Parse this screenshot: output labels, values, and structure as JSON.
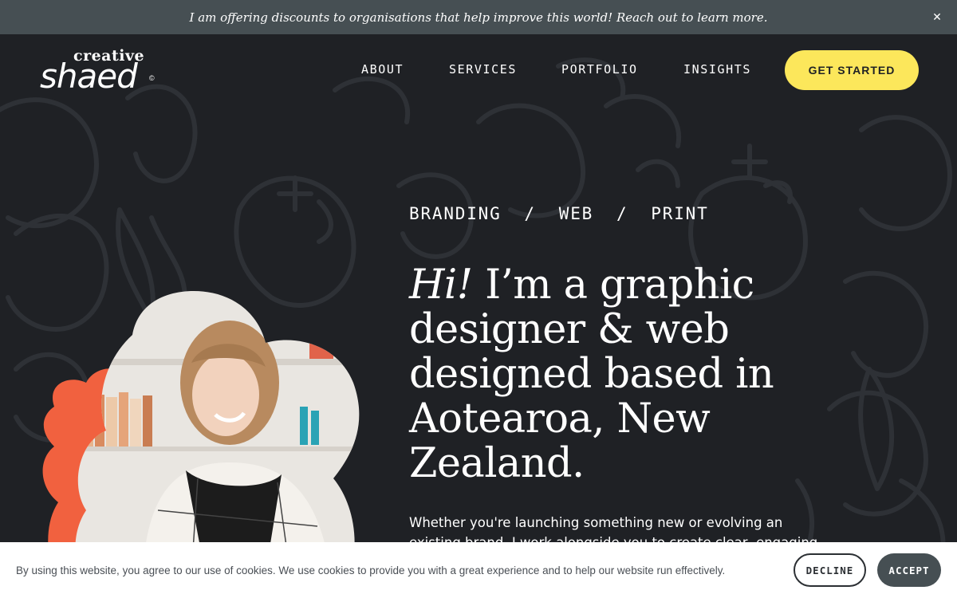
{
  "announcement": {
    "text": "I am offering discounts to organisations that help improve this world! Reach out to learn more.",
    "close_icon": "close-icon"
  },
  "header": {
    "logo_top": "creative",
    "logo_main": "shaed",
    "logo_mark": "©",
    "nav": [
      "ABOUT",
      "SERVICES",
      "PORTFOLIO",
      "INSIGHTS"
    ],
    "cta_label": "GET STARTED"
  },
  "hero": {
    "tagline": "BRANDING  /  WEB  /  PRINT",
    "headline_em": "Hi!",
    "headline_rest": " I’m a graphic designer & web designed based in Aotearoa, New Zealand.",
    "intro": "Whether you're launching something new or evolving an existing brand, I work alongside you to create clear, engaging and"
  },
  "cookie": {
    "text": "By using this website, you agree to our use of cookies. We use cookies to provide you with a great experience and to help our website run effectively.",
    "decline_label": "DECLINE",
    "accept_label": "ACCEPT"
  },
  "colors": {
    "background": "#1f2125",
    "announcement_bar": "#464f53",
    "accent_yellow": "#fce75b",
    "accent_orange": "#f1613f"
  }
}
